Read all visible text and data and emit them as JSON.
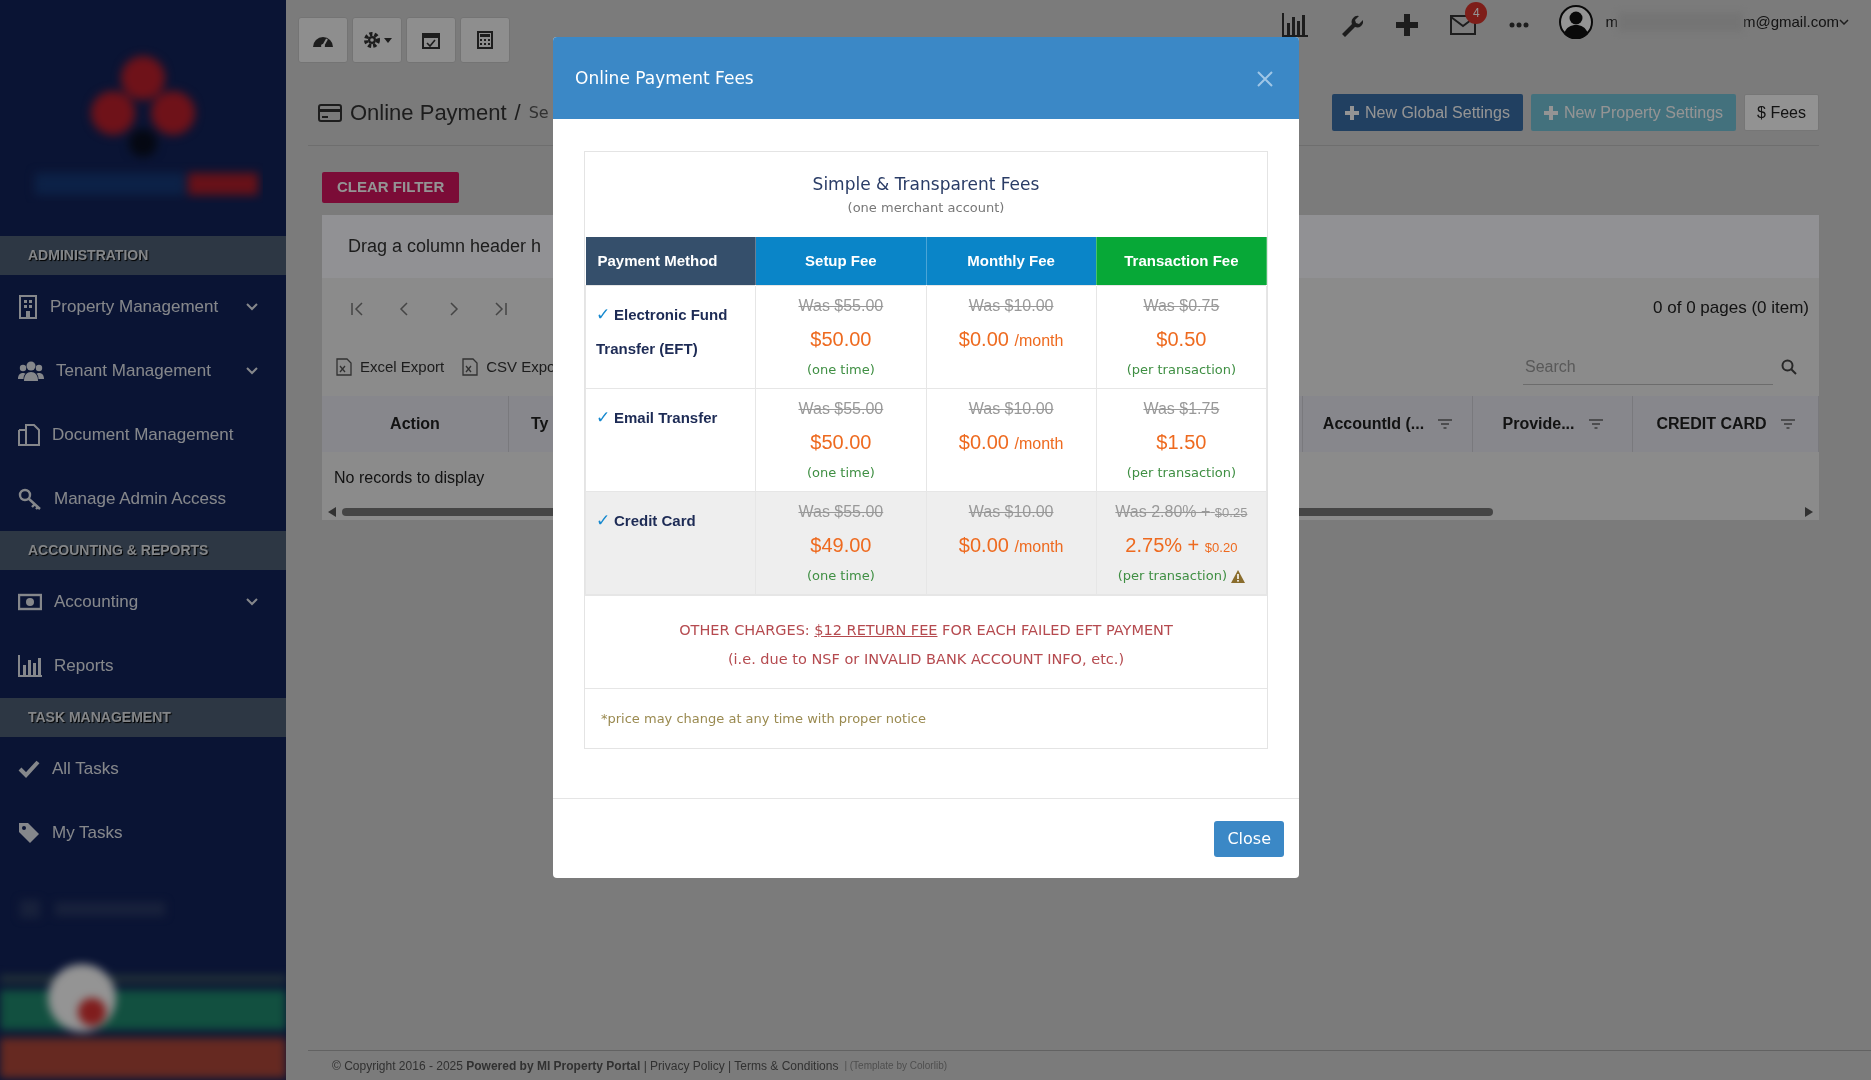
{
  "topbar": {
    "tools": [
      {
        "kind": "dashboard",
        "caret": false
      },
      {
        "kind": "gear",
        "caret": true
      },
      {
        "kind": "calendar",
        "caret": false
      },
      {
        "kind": "calculator",
        "caret": false
      }
    ],
    "mail_badge": "4",
    "email_start": "m",
    "email_end": "m@gmail.com"
  },
  "sidebar": {
    "sections": [
      {
        "title": "ADMINISTRATION",
        "items": [
          {
            "label": "Property Management",
            "submenu": true
          },
          {
            "label": "Tenant Management",
            "submenu": true
          },
          {
            "label": "Document Management",
            "submenu": false
          },
          {
            "label": "Manage Admin Access",
            "submenu": false
          }
        ]
      },
      {
        "title": "ACCOUNTING & REPORTS",
        "items": [
          {
            "label": "Accounting",
            "submenu": true
          },
          {
            "label": "Reports",
            "submenu": false
          }
        ]
      },
      {
        "title": "TASK MANAGEMENT",
        "items": [
          {
            "label": "All Tasks",
            "submenu": false
          },
          {
            "label": "My Tasks",
            "submenu": false
          }
        ]
      }
    ]
  },
  "page": {
    "title": "Online Payment",
    "separator": "/",
    "crumb": "Se",
    "buttons": [
      {
        "label": "New Global Settings",
        "kind": "global"
      },
      {
        "label": "New Property Settings",
        "kind": "property"
      },
      {
        "label": "$ Fees",
        "kind": "fees"
      }
    ],
    "clear_filter": "CLEAR FILTER",
    "grid": {
      "group_hint": "Drag a column header h",
      "pager_info": "0 of 0 pages (0 item)",
      "exports": [
        "Excel Export",
        "CSV Expo"
      ],
      "search": {
        "placeholder": "Search"
      },
      "columns": [
        {
          "label": "Action",
          "filter": false
        },
        {
          "label": "Ty"
        },
        {
          "label": "AccountId (...",
          "filter": true
        },
        {
          "label": "Provide...",
          "filter": true
        },
        {
          "label": "CREDIT CARD",
          "filter": true
        }
      ],
      "empty": "No records to display"
    }
  },
  "footer": {
    "text": "© Copyright 2016 - 2025 **Powered by MI Property Portal** | Privacy Policy | Terms & Conditions",
    "template": "| (Template by Colorlib)"
  },
  "modal": {
    "title": "Online Payment Fees",
    "heading": "Simple & Transparent Fees",
    "subheading": "(one merchant account)",
    "columns": [
      {
        "label": "Payment Method",
        "color": "#354f6b"
      },
      {
        "label": "Setup Fee",
        "color": "#0a85c8"
      },
      {
        "label": "Monthly Fee",
        "color": "#0a85c8"
      },
      {
        "label": "Transaction Fee",
        "color": "#07a837"
      }
    ],
    "rows": [
      {
        "check": "✓",
        "method": "Electronic Fund Transfer (EFT)",
        "shaded": false,
        "fees": [
          {
            "was": "Was $55.00",
            "price": "$50.00",
            "note": "(one time)"
          },
          {
            "was": "Was $10.00",
            "price": "$0.00",
            "unit": "/month"
          },
          {
            "was": "Was $0.75",
            "price": "$0.50",
            "note": "(per transaction)",
            "warning": false
          }
        ]
      },
      {
        "check": "✓",
        "method": "Email Transfer",
        "shaded": false,
        "fees": [
          {
            "was": "Was $55.00",
            "price": "$50.00",
            "note": "(one time)"
          },
          {
            "was": "Was $10.00",
            "price": "$0.00",
            "unit": "/month"
          },
          {
            "was": "Was $1.75",
            "price": "$1.50",
            "note": "(per transaction)",
            "warning": false
          }
        ]
      },
      {
        "check": "✓",
        "method": "Credit Card",
        "shaded": true,
        "fees": [
          {
            "was": "Was $55.00",
            "price": "$49.00",
            "note": "(one time)"
          },
          {
            "was": "Was $10.00",
            "price": "$0.00",
            "unit": "/month"
          },
          {
            "was": "Was 2.80% +",
            "was_small": "$0.25",
            "price": "2.75% +",
            "price_small": "$0.20",
            "note": "(per transaction)",
            "warning": true
          }
        ]
      }
    ],
    "other_charges": {
      "prefix": "OTHER CHARGES:",
      "link": "$12 RETURN FEE",
      "suffix": "FOR EACH FAILED EFT PAYMENT",
      "detail": "(i.e. due to NSF or INVALID BANK ACCOUNT INFO, etc.)"
    },
    "note": "*price may change at any time with proper notice",
    "close_button": "Close"
  }
}
